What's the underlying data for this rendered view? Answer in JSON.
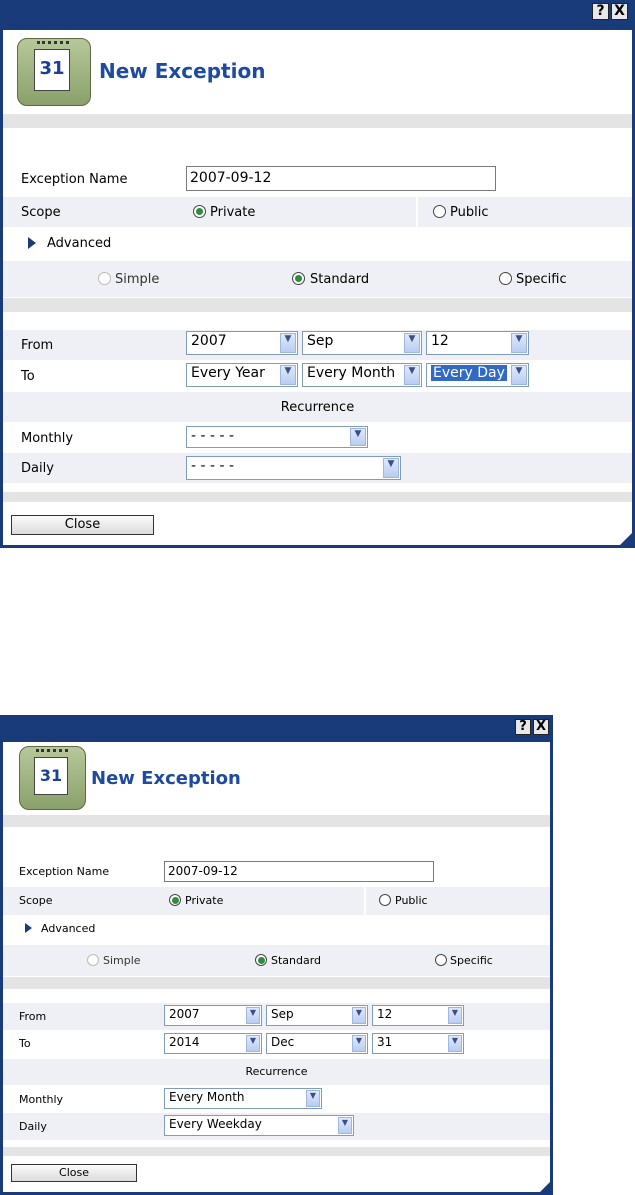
{
  "dialogs": [
    {
      "title": "New Exception",
      "icon_day": "31",
      "help_label": "?",
      "close_x_label": "X",
      "exception_name": {
        "label": "Exception Name",
        "value": "2007-09-12"
      },
      "scope": {
        "label": "Scope",
        "private": "Private",
        "public": "Public",
        "selected": "Private"
      },
      "advanced_label": "Advanced",
      "mode": {
        "simple": "Simple",
        "standard": "Standard",
        "specific": "Specific",
        "selected": "Standard"
      },
      "from": {
        "label": "From",
        "year": "2007",
        "month": "Sep",
        "day": "12"
      },
      "to": {
        "label": "To",
        "year": "Every Year",
        "month": "Every Month",
        "day": "Every Day"
      },
      "recurrence_label": "Recurrence",
      "monthly": {
        "label": "Monthly",
        "value": "- - - - -"
      },
      "daily": {
        "label": "Daily",
        "value": "- - - - -"
      },
      "close_label": "Close"
    },
    {
      "title": "New Exception",
      "icon_day": "31",
      "help_label": "?",
      "close_x_label": "X",
      "exception_name": {
        "label": "Exception Name",
        "value": "2007-09-12"
      },
      "scope": {
        "label": "Scope",
        "private": "Private",
        "public": "Public",
        "selected": "Private"
      },
      "advanced_label": "Advanced",
      "mode": {
        "simple": "Simple",
        "standard": "Standard",
        "specific": "Specific",
        "selected": "Standard"
      },
      "from": {
        "label": "From",
        "year": "2007",
        "month": "Sep",
        "day": "12"
      },
      "to": {
        "label": "To",
        "year": "2014",
        "month": "Dec",
        "day": "31"
      },
      "recurrence_label": "Recurrence",
      "monthly": {
        "label": "Monthly",
        "value": "Every Month"
      },
      "daily": {
        "label": "Daily",
        "value": "Every Weekday"
      },
      "close_label": "Close"
    }
  ],
  "colors": {
    "frame": "#1a3b7a",
    "title": "#1e4aa0",
    "radio_on": "#2a8f3a",
    "selection": "#316ac5"
  }
}
